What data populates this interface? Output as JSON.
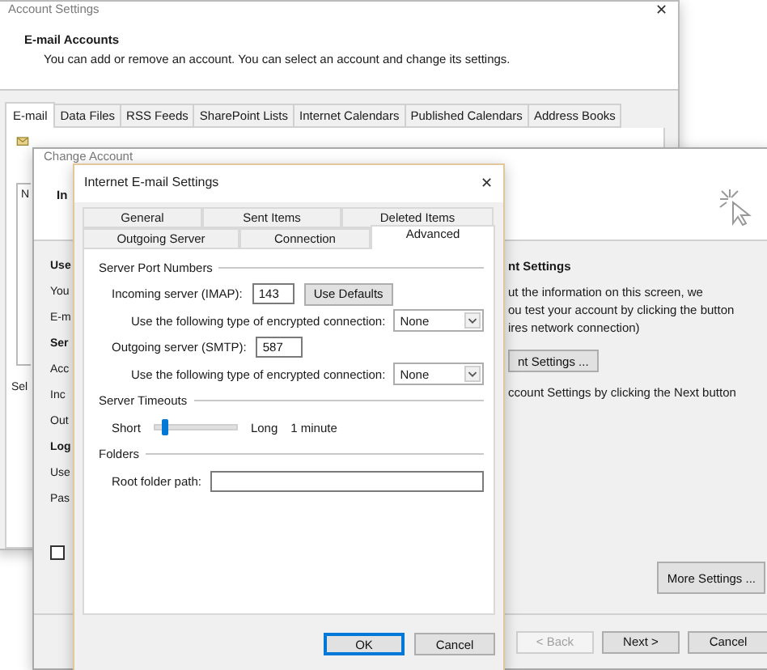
{
  "account_settings": {
    "title": "Account Settings",
    "close": "✕",
    "heading": "E-mail Accounts",
    "description": "You can add or remove an account. You can select an account and change its settings.",
    "tabs": [
      {
        "label": "E-mail",
        "selected": true
      },
      {
        "label": "Data Files",
        "selected": false
      },
      {
        "label": "RSS Feeds",
        "selected": false
      },
      {
        "label": "SharePoint Lists",
        "selected": false
      },
      {
        "label": "Internet Calendars",
        "selected": false
      },
      {
        "label": "Published Calendars",
        "selected": false
      },
      {
        "label": "Address Books",
        "selected": false
      }
    ],
    "list_fragment": "N",
    "footer_fragment": "Sel"
  },
  "change_account": {
    "title": "Change Account",
    "heading_fragment": "In",
    "left_labels": [
      {
        "text": "Use",
        "bold": true
      },
      {
        "text": "You",
        "bold": false
      },
      {
        "text": "E-m",
        "bold": false
      },
      {
        "text": "Ser",
        "bold": true
      },
      {
        "text": "Acc",
        "bold": false
      },
      {
        "text": "Inc",
        "bold": false
      },
      {
        "text": "Out",
        "bold": false
      },
      {
        "text": "Log",
        "bold": true
      },
      {
        "text": "Use",
        "bold": false
      },
      {
        "text": "Pas",
        "bold": false
      }
    ],
    "remember_checked": false,
    "right_heading": "nt Settings",
    "right_lines": [
      "ut the information on this screen, we",
      "ou test your account by clicking the button",
      "ires network connection)"
    ],
    "test_button": "nt Settings ...",
    "right_note": "ccount Settings by clicking the Next button",
    "more_settings": "More Settings ...",
    "buttons": [
      {
        "label": "< Back",
        "disabled": true
      },
      {
        "label": "Next >",
        "disabled": false
      },
      {
        "label": "Cancel",
        "disabled": false
      }
    ]
  },
  "internet_email_settings": {
    "title": "Internet E-mail Settings",
    "close": "✕",
    "tabs_row1": [
      {
        "label": "General",
        "selected": false
      },
      {
        "label": "Sent Items",
        "selected": false
      },
      {
        "label": "Deleted Items",
        "selected": false
      }
    ],
    "tabs_row2": [
      {
        "label": "Outgoing Server",
        "selected": false
      },
      {
        "label": "Connection",
        "selected": false
      },
      {
        "label": "Advanced",
        "selected": true
      }
    ],
    "port_group": "Server Port Numbers",
    "incoming_label": "Incoming server (IMAP):",
    "incoming_port": "143",
    "use_defaults": "Use Defaults",
    "encryption_label_1": "Use the following type of encrypted connection:",
    "encryption_1": "None",
    "outgoing_label": "Outgoing server (SMTP):",
    "outgoing_port": "587",
    "encryption_label_2": "Use the following type of encrypted connection:",
    "encryption_2": "None",
    "timeout_group": "Server Timeouts",
    "timeout": {
      "short": "Short",
      "long": "Long",
      "value": "1 minute",
      "level": 0.08
    },
    "folders_group": "Folders",
    "root_label": "Root folder path:",
    "buttons": [
      {
        "label": "OK",
        "default": true
      },
      {
        "label": "Cancel",
        "default": false
      }
    ]
  }
}
